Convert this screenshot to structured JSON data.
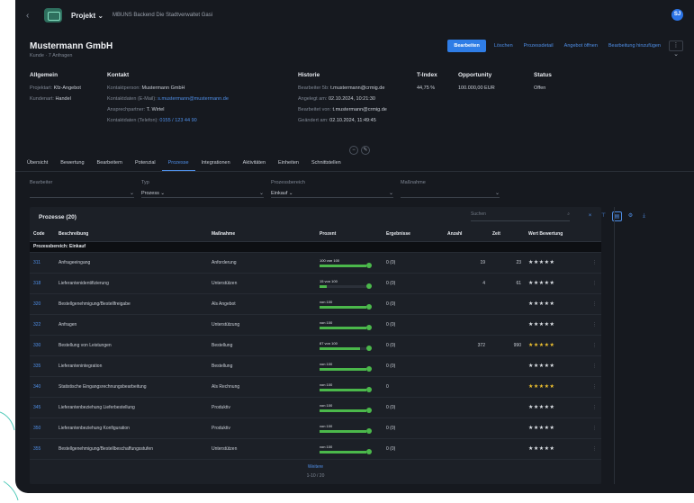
{
  "topbar": {
    "project_label": "Projekt ⌄",
    "breadcrumb": "MBUNS Backend Die Stadtverwaltet Gasi",
    "avatar_initials": "SJ"
  },
  "company": {
    "name": "Mustermann GmbH",
    "sub": "Kunde · 7 Anfragen"
  },
  "actions": {
    "primary": "Bearbeiten",
    "links": [
      "Löschen",
      "Prozessdetail",
      "Angebot öffnen",
      "Bearbeitung hinzufügen"
    ],
    "more": "⋮ ⌄"
  },
  "info": {
    "allgemein": {
      "title": "Allgemein",
      "rows": [
        {
          "label": "Projektart:",
          "value": "Kfz-Angebot"
        },
        {
          "label": "Kundenart:",
          "value": "Handel"
        }
      ]
    },
    "kontakt": {
      "title": "Kontakt",
      "rows": [
        {
          "label": "Kontaktperson:",
          "value": "Mustermann GmbH"
        },
        {
          "label": "Kontaktdaten (E-Mail):",
          "value": "s.mustermann@mustermann.de"
        },
        {
          "label": "Ansprechpartner:",
          "value": "T. Wirtel"
        },
        {
          "label": "Kontaktdaten (Telefon):",
          "value": "0155 / 123 44 90"
        }
      ]
    },
    "historie": {
      "title": "Historie",
      "rows": [
        {
          "label": "Bearbeiter 5b:",
          "value": "t.mustermann@crmig.de"
        },
        {
          "label": "Angelegt am:",
          "value": "02.10.2024, 10:21:30"
        },
        {
          "label": "Bearbeitet von:",
          "value": "t.mustermann@crmig.de"
        },
        {
          "label": "Geändert am:",
          "value": "02.10.2024, 11:49:45"
        }
      ]
    },
    "tindex": {
      "title": "T-Index",
      "value": "44,75 %"
    },
    "opportunity": {
      "title": "Opportunity",
      "value": "100.000,00 EUR"
    },
    "status": {
      "title": "Status",
      "value": "Offen"
    }
  },
  "tabs": [
    "Übersicht",
    "Bewertung",
    "Bearbeitern",
    "Potenzial",
    "Prozesse",
    "Integrationen",
    "Aktivitäten",
    "Einheiten",
    "Schnittstellen"
  ],
  "active_tab": 4,
  "filters": [
    {
      "label": "Bearbeiter",
      "value": ""
    },
    {
      "label": "Typ",
      "value": "Prozess ⌄"
    },
    {
      "label": "Prozessbereich",
      "value": "Einkauf ⌄"
    },
    {
      "label": "Maßnahme",
      "value": ""
    }
  ],
  "table": {
    "title": "Prozesse (20)",
    "search_placeholder": "Suchen",
    "columns": [
      "Code",
      "Beschreibung",
      "Maßnahme",
      "Prozent",
      "Ergebnisse",
      "Anzahl",
      "Zeit",
      "Wert",
      "Bewertung"
    ],
    "group": "Prozessbereich: Einkauf",
    "rows": [
      {
        "code": "311",
        "desc": "Anfrageeingang",
        "measure": "Anforderung",
        "pct_text": "100 von 100",
        "pct": 1.0,
        "result": "0 (0)",
        "count": "19",
        "time": "23",
        "stars": "★★★★★",
        "gold": false
      },
      {
        "code": "318",
        "desc": "Lieferantenidentifizierung",
        "measure": "Unterstützen",
        "pct_text": "15 von 100",
        "pct": 0.15,
        "result": "0 (0)",
        "count": "4",
        "time": "61",
        "stars": "★★★★★",
        "gold": false
      },
      {
        "code": "320",
        "desc": "Bestellgenehmigung/Bestellfreigabe",
        "measure": "Als Angebot",
        "pct_text": "von 100",
        "pct": 1.0,
        "result": "0 (0)",
        "count": "",
        "time": "",
        "stars": "★★★★★",
        "gold": false
      },
      {
        "code": "322",
        "desc": "Anfragen",
        "measure": "Unterstützung",
        "pct_text": "von 100",
        "pct": 1.0,
        "result": "0 (0)",
        "count": "",
        "time": "",
        "stars": "★★★★★",
        "gold": false
      },
      {
        "code": "330",
        "desc": "Bestellung von Leistungen",
        "measure": "Bestellung",
        "pct_text": "87 von 100",
        "pct": 0.87,
        "result": "0 (0)",
        "count": "372",
        "time": "990",
        "stars": "★★★★★",
        "gold": true
      },
      {
        "code": "335",
        "desc": "Lieferantenintegration",
        "measure": "Bestellung",
        "pct_text": "von 100",
        "pct": 1.0,
        "result": "0 (0)",
        "count": "",
        "time": "",
        "stars": "★★★★★",
        "gold": false
      },
      {
        "code": "340",
        "desc": "Statistische Eingangsrechnungsbearbeitung",
        "measure": "Als Rechnung",
        "pct_text": "von 100",
        "pct": 1.0,
        "result": "0",
        "count": "",
        "time": "",
        "stars": "★★★★★",
        "gold": true
      },
      {
        "code": "345",
        "desc": "Lieferantenbeziehung Lieferbestellung",
        "measure": "Produktiv",
        "pct_text": "von 100",
        "pct": 1.0,
        "result": "0 (0)",
        "count": "",
        "time": "",
        "stars": "★★★★★",
        "gold": false
      },
      {
        "code": "350",
        "desc": "Lieferantenbeziehung Konfiguration",
        "measure": "Produktiv",
        "pct_text": "von 100",
        "pct": 1.0,
        "result": "0 (0)",
        "count": "",
        "time": "",
        "stars": "★★★★★",
        "gold": false
      },
      {
        "code": "355",
        "desc": "Bestellgenehmigung/Bestellbeschaffungsstufen",
        "measure": "Unterstützen",
        "pct_text": "von 100",
        "pct": 1.0,
        "result": "0 (0)",
        "count": "",
        "time": "",
        "stars": "★★★★★",
        "gold": false
      }
    ],
    "pager_more": "Weitere",
    "pager_info": "1-10 / 20"
  },
  "colors": {
    "accent": "#2f7de6",
    "progress": "#4bb84b",
    "star_gold": "#f0c22f",
    "deco_teal": "#4fc9b8"
  }
}
